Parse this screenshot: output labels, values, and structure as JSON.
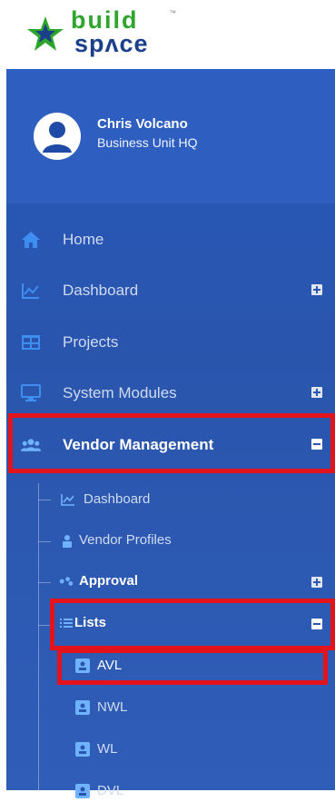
{
  "logo": {
    "line1": "build",
    "line2": "spʌce",
    "tm": "™"
  },
  "profile": {
    "name": "Chris Volcano",
    "unit": "Business Unit HQ"
  },
  "menu": {
    "home": "Home",
    "dashboard": "Dashboard",
    "projects": "Projects",
    "system_modules": "System Modules",
    "vendor_management": "Vendor Management"
  },
  "vendor_sub": {
    "dashboard": "Dashboard",
    "vendor_profiles": "Vendor Profiles",
    "approval": "Approval",
    "lists": "Lists"
  },
  "lists_sub": {
    "avl": "AVL",
    "nwl": "NWL",
    "wl": "WL",
    "dvl": "DVL"
  },
  "colors": {
    "sidebar": "#2a55ad",
    "highlight": "#e3131b",
    "brand_green": "#2ea52c",
    "brand_blue": "#1b3f8a"
  }
}
